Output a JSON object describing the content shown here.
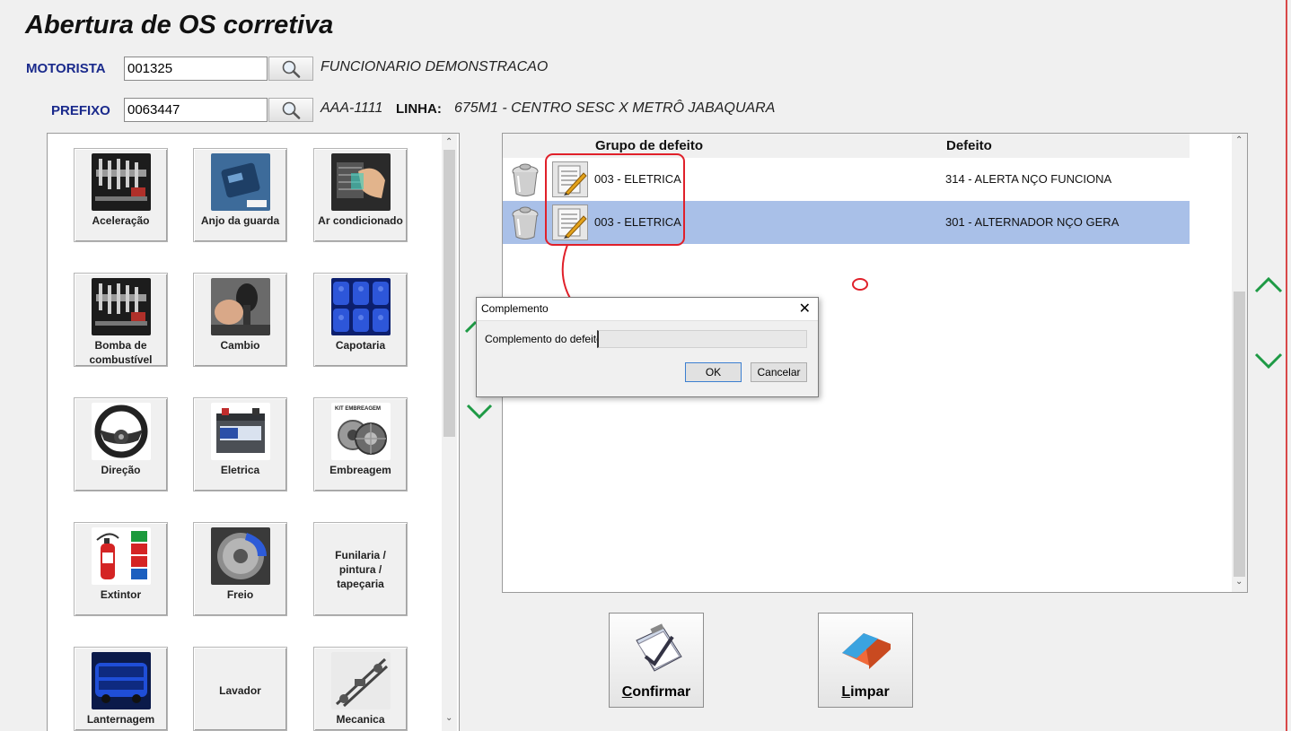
{
  "form": {
    "title": "Abertura de OS corretiva",
    "motorista_label": "MOTORISTA",
    "motorista_value": "001325",
    "motorista_name": "FUNCIONARIO DEMONSTRACAO",
    "prefixo_label": "PREFIXO",
    "prefixo_value": "0063447",
    "placa": "AAA-1111",
    "linha_label": "LINHA:",
    "linha_value": "675M1 - CENTRO SESC X METRÔ JABAQUARA"
  },
  "categories": [
    {
      "label": "Aceleração",
      "icon": "engine-parts-image"
    },
    {
      "label": "Anjo da guarda",
      "icon": "anjo-device-image"
    },
    {
      "label": "Ar condicionado",
      "icon": "ac-vent-image"
    },
    {
      "label": "Bomba de combustível",
      "icon": "fuel-pump-image"
    },
    {
      "label": "Cambio",
      "icon": "gear-shift-image"
    },
    {
      "label": "Capotaria",
      "icon": "bus-seats-image"
    },
    {
      "label": "Direção",
      "icon": "steering-wheel-image"
    },
    {
      "label": "Eletrica",
      "icon": "battery-image"
    },
    {
      "label": "Embreagem",
      "icon": "clutch-kit-image",
      "image_text": "KIT EMBREAGEM"
    },
    {
      "label": "Extintor",
      "icon": "fire-extinguisher-image"
    },
    {
      "label": "Freio",
      "icon": "brake-disc-image"
    },
    {
      "label": "Funilaria / pintura / tapeçaria",
      "icon": ""
    },
    {
      "label": "Lanternagem",
      "icon": "bus-image"
    },
    {
      "label": "Lavador",
      "icon": ""
    },
    {
      "label": "Mecanica",
      "icon": "chassis-image"
    }
  ],
  "defects": {
    "col_group": "Grupo de defeito",
    "col_defect": "Defeito",
    "rows": [
      {
        "group": "003 - ELETRICA",
        "defect": "314 - ALERTA NÇO FUNCIONA",
        "selected": false
      },
      {
        "group": "003 - ELETRICA",
        "defect": "301 - ALTERNADOR NÇO GERA",
        "selected": true
      }
    ]
  },
  "buttons": {
    "confirmar": "Confirmar",
    "limpar": "Limpar"
  },
  "dialog": {
    "title": "Complemento",
    "field_label": "Complemento do defeito",
    "field_value": "",
    "ok": "OK",
    "cancel": "Cancelar"
  },
  "colors": {
    "label_blue": "#1a2a8c",
    "selected_row": "#a9c0e8",
    "arrow_green": "#1e9a45",
    "annotation_red": "#e0202a"
  }
}
